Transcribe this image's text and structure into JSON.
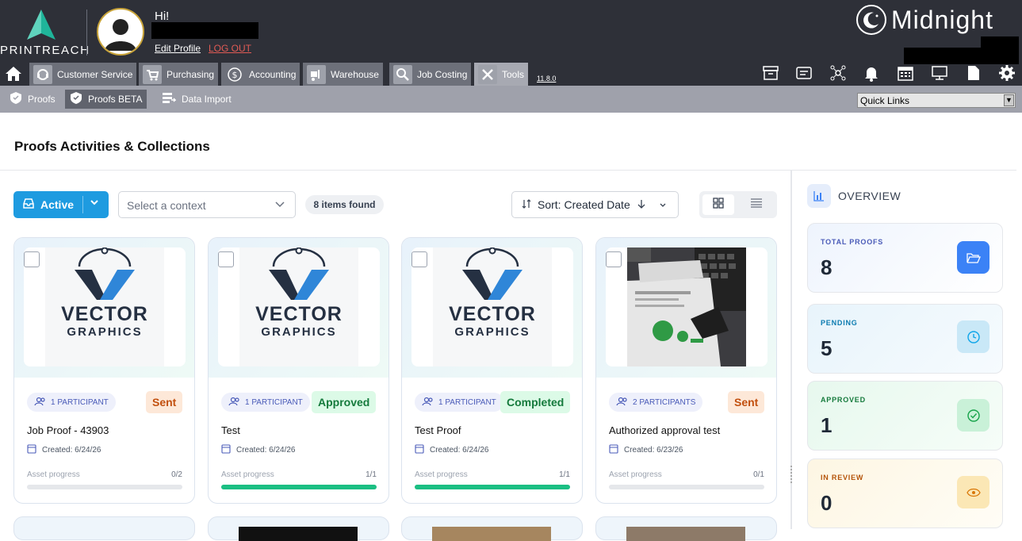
{
  "header": {
    "logo_text": "PRINTREACH",
    "greeting": "Hi!",
    "edit_profile": "Edit Profile",
    "logout": "LOG OUT",
    "brand": "Midnight"
  },
  "nav": {
    "tabs": [
      {
        "label": "Customer Service",
        "icon": "headset-icon"
      },
      {
        "label": "Purchasing",
        "icon": "cart-icon"
      },
      {
        "label": "Accounting",
        "icon": "dollar-icon"
      },
      {
        "label": "Warehouse",
        "icon": "forklift-icon"
      },
      {
        "label": "Job Costing",
        "icon": "magnifier-icon"
      },
      {
        "label": "Tools",
        "icon": "tools-icon",
        "active": true
      }
    ],
    "version": "11.8.0",
    "right_icons": [
      "archive-icon",
      "id-card-icon",
      "network-icon",
      "bell-icon",
      "calendar-icon",
      "monitor-icon",
      "document-icon",
      "gear-icon"
    ]
  },
  "subnav": {
    "tabs": [
      {
        "label": "Proofs",
        "icon": "shield-icon"
      },
      {
        "label": "Proofs BETA",
        "icon": "shield-icon",
        "active": true
      },
      {
        "label": "Data Import",
        "icon": "data-import-icon"
      }
    ],
    "quick_links": "Quick Links"
  },
  "page": {
    "title": "Proofs Activities & Collections"
  },
  "toolbar": {
    "active_label": "Active",
    "context_placeholder": "Select a context",
    "items_found": "8 items found",
    "sort_label": "Sort: Created Date"
  },
  "cards": [
    {
      "participants": "1 PARTICIPANT",
      "status": "Sent",
      "title": "Job Proof - 43903",
      "created": "Created: 6/24/26",
      "asset_label": "Asset progress",
      "asset_progress": "0/2",
      "progress": 0,
      "logo_line1": "VECTOR",
      "logo_line2": "GRAPHICS"
    },
    {
      "participants": "1 PARTICIPANT",
      "status": "Approved",
      "title": "Test",
      "created": "Created: 6/24/26",
      "asset_label": "Asset progress",
      "asset_progress": "1/1",
      "progress": 1,
      "logo_line1": "VECTOR",
      "logo_line2": "GRAPHICS"
    },
    {
      "participants": "1 PARTICIPANT",
      "status": "Completed",
      "title": "Test Proof",
      "created": "Created: 6/24/26",
      "asset_label": "Asset progress",
      "asset_progress": "1/1",
      "progress": 1,
      "logo_line1": "VECTOR",
      "logo_line2": "GRAPHICS"
    },
    {
      "participants": "2 PARTICIPANTS",
      "status": "Sent",
      "title": "Authorized approval test",
      "created": "Created: 6/23/26",
      "asset_label": "Asset progress",
      "asset_progress": "0/1",
      "progress": 0
    }
  ],
  "overview": {
    "title": "OVERVIEW",
    "stats": [
      {
        "label": "TOTAL PROOFS",
        "value": "8",
        "color": "#3b82f6"
      },
      {
        "label": "PENDING",
        "value": "5",
        "color": "#0ea5e9"
      },
      {
        "label": "APPROVED",
        "value": "1",
        "color": "#16a34a"
      },
      {
        "label": "IN REVIEW",
        "value": "0",
        "color": "#d97706"
      }
    ]
  }
}
